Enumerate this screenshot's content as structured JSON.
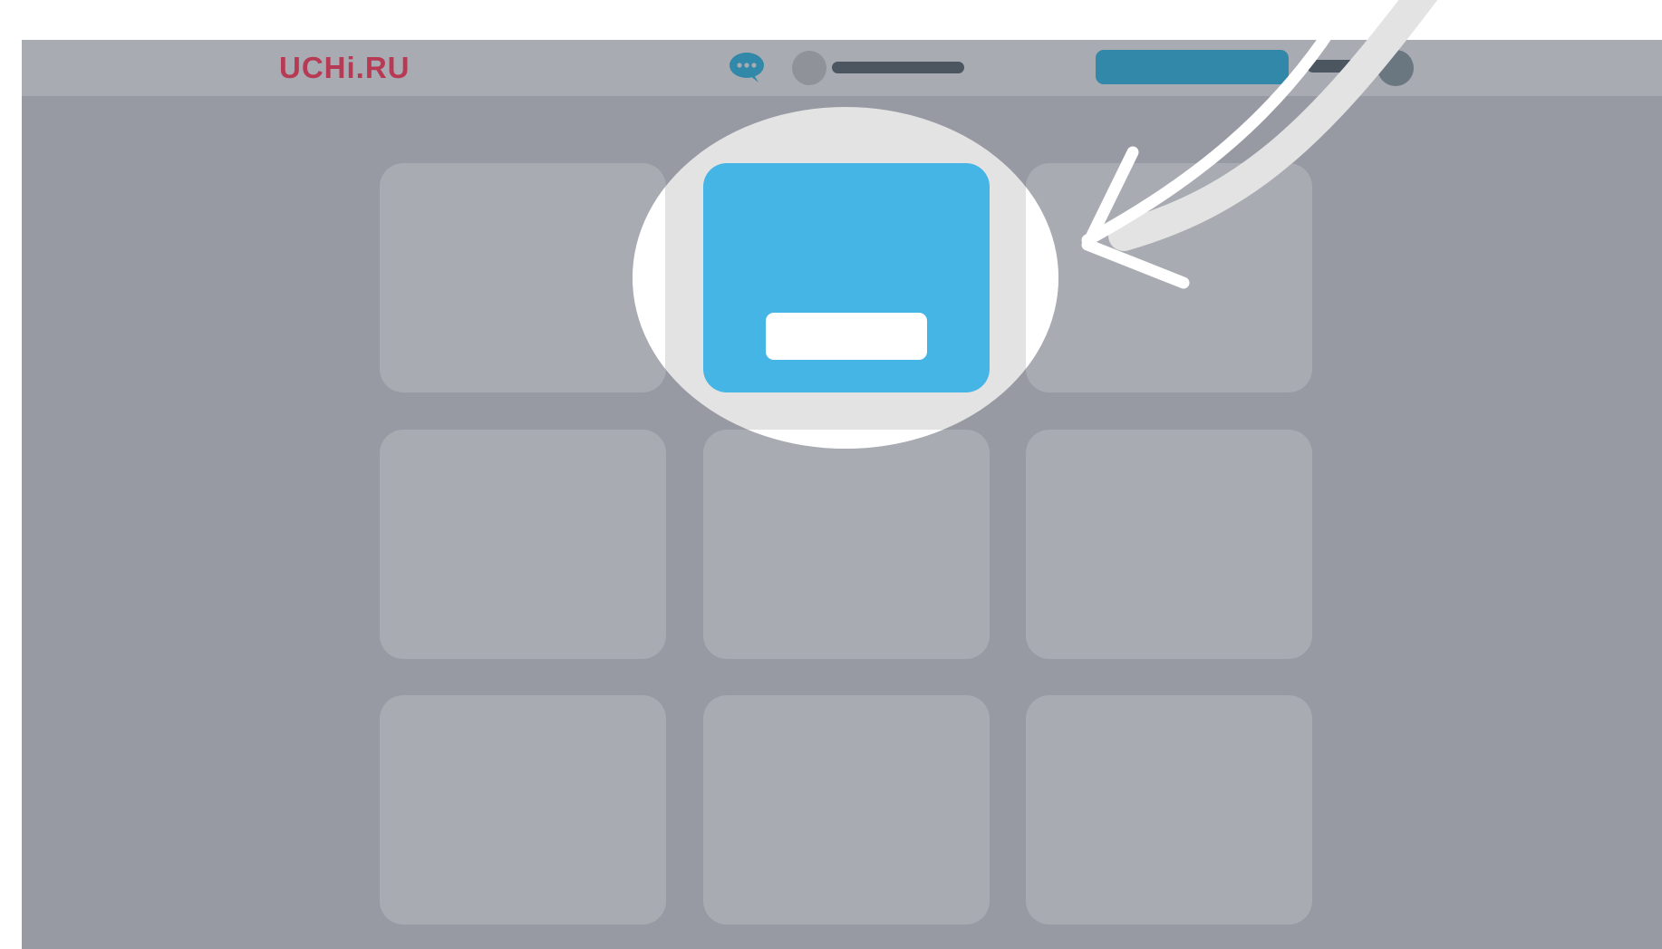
{
  "header": {
    "logo_text": "UCHi.RU",
    "logo_color": "#b73a55",
    "chat_icon": "speech-bubble-icon",
    "accent_button_color": "#3188a9"
  },
  "content": {
    "tile_count": 9,
    "highlighted_tile_color": "#45b5e6",
    "arrow_icon": "curved-arrow-icon"
  }
}
